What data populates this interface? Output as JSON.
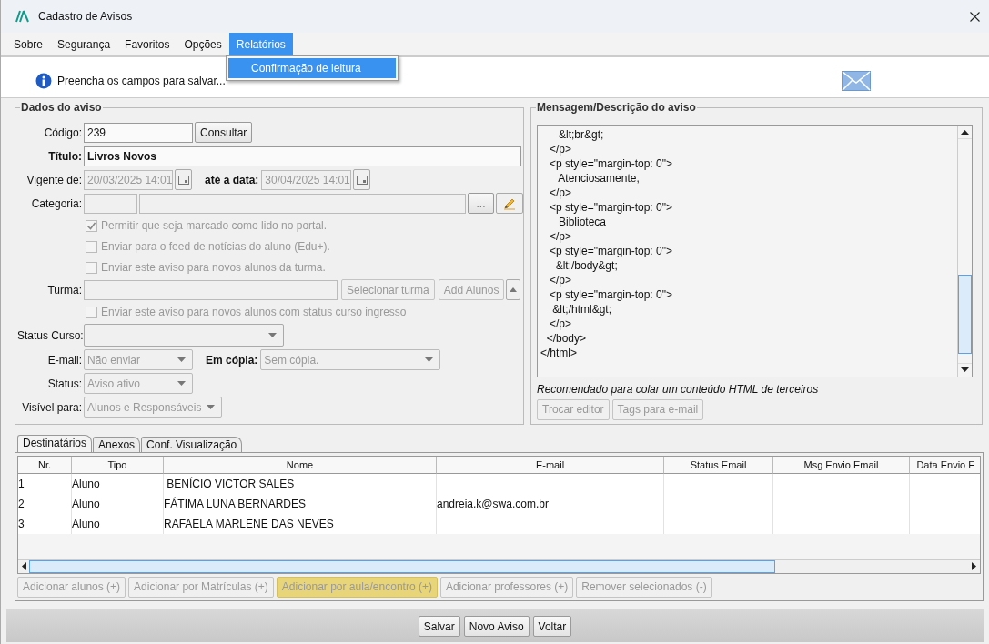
{
  "window": {
    "title": "Cadastro de Avisos"
  },
  "menu": [
    {
      "label": "Sobre",
      "selected": false
    },
    {
      "label": "Segurança",
      "selected": false
    },
    {
      "label": "Favoritos",
      "selected": false
    },
    {
      "label": "Opções",
      "selected": false
    },
    {
      "label": "Relatórios",
      "selected": true
    }
  ],
  "dropdown": [
    {
      "label": "Confirmação de leitura",
      "selected": true
    }
  ],
  "info": {
    "message": "Preencha os campos para salvar..."
  },
  "aviso": {
    "title": "Dados do aviso",
    "codigo": {
      "label": "Código:",
      "value": "239"
    },
    "consultar": {
      "label": "Consultar"
    },
    "titulo": {
      "label": "Título:",
      "value": "Livros Novos"
    },
    "vigente": {
      "label": "Vigente de:",
      "value": "20/03/2025 14:01",
      "disabled": true
    },
    "ate": {
      "label": "até a data:",
      "value": "30/04/2025 14:01",
      "disabled": true
    },
    "categoria": {
      "label": "Categoria:"
    },
    "categoria_button": {
      "label": "..."
    },
    "options": [
      {
        "label": "Permitir que seja marcado como lido no portal.",
        "checked": true,
        "disabled": true
      },
      {
        "label": "Enviar para o feed de notícias do aluno (Edu+).",
        "checked": false,
        "disabled": true
      },
      {
        "label": "Enviar este aviso para novos alunos da turma.",
        "checked": false,
        "disabled": true
      }
    ],
    "turma": {
      "label": "Turma:"
    },
    "turma_buttons": [
      {
        "label": "Selecionar turma",
        "disabled": true
      },
      {
        "label": "Add Alunos",
        "disabled": true
      }
    ],
    "ingresso": {
      "label": "Enviar este aviso para novos alunos com status curso ingresso",
      "checked": false,
      "disabled": true
    },
    "status_curso": {
      "label": "Status Curso:"
    },
    "email": {
      "label": "E-mail:",
      "value": "Não enviar",
      "disabled": true
    },
    "em_copia": {
      "label": "Em cópia:",
      "value": "Sem cópia.",
      "disabled": true
    },
    "status": {
      "label": "Status:",
      "value": "Aviso ativo",
      "disabled": true
    },
    "visivel": {
      "label": "Visível para:",
      "value": "Alunos e Responsáveis",
      "disabled": true
    }
  },
  "mensagem": {
    "title": "Mensagem/Descrição do aviso",
    "lines": [
      "      &lt;br&gt;",
      "   </p>",
      "   <p style=\"margin-top: 0\">",
      "      Atenciosamente,",
      "   </p>",
      "   <p style=\"margin-top: 0\">",
      "      Biblioteca",
      "   </p>",
      "   <p style=\"margin-top: 0\">",
      "     &lt;/body&gt;",
      "   </p>",
      "   <p style=\"margin-top: 0\">",
      "    &lt;/html&gt;",
      "   </p>",
      "  </body>",
      "</html>"
    ],
    "note": "Recomendado para colar um conteúdo HTML de terceiros",
    "buttons": [
      {
        "label": "Trocar editor",
        "disabled": true
      },
      {
        "label": "Tags para e-mail",
        "disabled": true
      }
    ]
  },
  "tabs": [
    {
      "label": "Destinatários",
      "selected": true
    },
    {
      "label": "Anexos",
      "selected": false
    },
    {
      "label": "Conf. Visualização",
      "selected": false
    }
  ],
  "table": {
    "columns": [
      "Nr.",
      "Tipo",
      "Nome",
      "E-mail",
      "Status Email",
      "Msg Envio Email",
      "Data Envio E"
    ],
    "rows": [
      [
        "1",
        "Aluno",
        " BENÍCIO VICTOR SALES",
        "",
        "",
        "",
        ""
      ],
      [
        "2",
        "Aluno",
        "FÁTIMA LUNA BERNARDES",
        "andreia.k@swa.com.br",
        "",
        "",
        ""
      ],
      [
        "3",
        "Aluno",
        "RAFAELA MARLENE DAS NEVES",
        "",
        "",
        "",
        ""
      ]
    ]
  },
  "table_buttons": [
    {
      "label": "Adicionar alunos (+)",
      "disabled": true,
      "highlighted": false
    },
    {
      "label": "Adicionar por Matrículas (+)",
      "disabled": true,
      "highlighted": false
    },
    {
      "label": "Adicionar por aula/encontro (+)",
      "disabled": true,
      "highlighted": true
    },
    {
      "label": "Adicionar professores (+)",
      "disabled": true,
      "highlighted": false
    },
    {
      "label": "Remover selecionados (-)",
      "disabled": true,
      "highlighted": false
    }
  ],
  "footer_buttons": [
    {
      "label": "Salvar"
    },
    {
      "label": "Novo Aviso"
    },
    {
      "label": "Voltar"
    }
  ]
}
